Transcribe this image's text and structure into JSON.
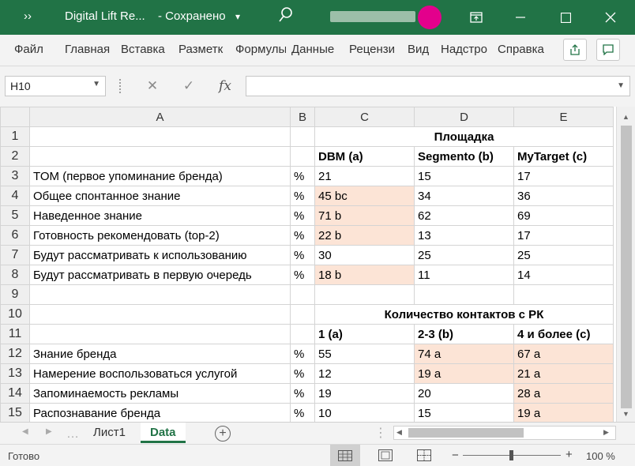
{
  "titlebar": {
    "quick_access": "››",
    "title": "Digital Lift Re...",
    "save_status": "- Сохранено",
    "dd": "▾"
  },
  "ribbon": {
    "tabs": [
      "Файл",
      "Главная",
      "Вставка",
      "Разметк",
      "Формулы",
      "Данные",
      "Рецензи",
      "Вид",
      "Надстро",
      "Справка"
    ]
  },
  "formula_bar": {
    "name_box": "H10",
    "cancel": "✕",
    "enter": "✓",
    "fx": "fx",
    "content": ""
  },
  "grid": {
    "col_headers": [
      "A",
      "B",
      "C",
      "D",
      "E"
    ],
    "row_numbers": [
      "1",
      "2",
      "3",
      "4",
      "5",
      "6",
      "7",
      "8",
      "9",
      "10",
      "11",
      "12",
      "13",
      "14",
      "15"
    ],
    "header1": "Площадка",
    "header2": [
      "DBM (a)",
      "Segmento (b)",
      "MyTarget (c)"
    ],
    "rows_a": [
      {
        "label": "TOM (первое упоминание бренда)",
        "unit": "%",
        "c": "21",
        "d": "15",
        "e": "17"
      },
      {
        "label": "Общее спонтанное знание",
        "unit": "%",
        "c": "45 bc",
        "d": "34",
        "e": "36"
      },
      {
        "label": "Наведенное знание",
        "unit": "%",
        "c": "71 b",
        "d": "62",
        "e": "69"
      },
      {
        "label": "Готовность рекомендовать (top-2)",
        "unit": "%",
        "c": "22 b",
        "d": "13",
        "e": "17"
      },
      {
        "label": "Будут рассматривать к использованию",
        "unit": "%",
        "c": "30",
        "d": "25",
        "e": "25"
      },
      {
        "label": "Будут рассматривать в первую очередь",
        "unit": "%",
        "c": "18 b",
        "d": "11",
        "e": "14"
      }
    ],
    "header10": "Количество контактов с РК",
    "header11": [
      "1 (a)",
      "2-3 (b)",
      "4 и более (c)"
    ],
    "rows_b": [
      {
        "label": "Знание бренда",
        "unit": "%",
        "c": "55",
        "d": "74 a",
        "e": "67 a"
      },
      {
        "label": "Намерение воспользоваться услугой",
        "unit": "%",
        "c": "12",
        "d": "19 a",
        "e": "21 a"
      },
      {
        "label": "Запоминаемость рекламы",
        "unit": "%",
        "c": "19",
        "d": "20",
        "e": "28 a"
      },
      {
        "label": "Распознавание бренда",
        "unit": "%",
        "c": "10",
        "d": "15",
        "e": "19 a"
      }
    ]
  },
  "sheets": {
    "tabs": [
      "Лист1",
      "Data"
    ],
    "active": "Data",
    "add": "+"
  },
  "status": {
    "ready": "Готово",
    "zoom": "100 %",
    "minus": "−",
    "plus": "+"
  },
  "colors": {
    "accent": "#217346",
    "highlight": "#fce4d6",
    "avatar": "#e3008c"
  }
}
